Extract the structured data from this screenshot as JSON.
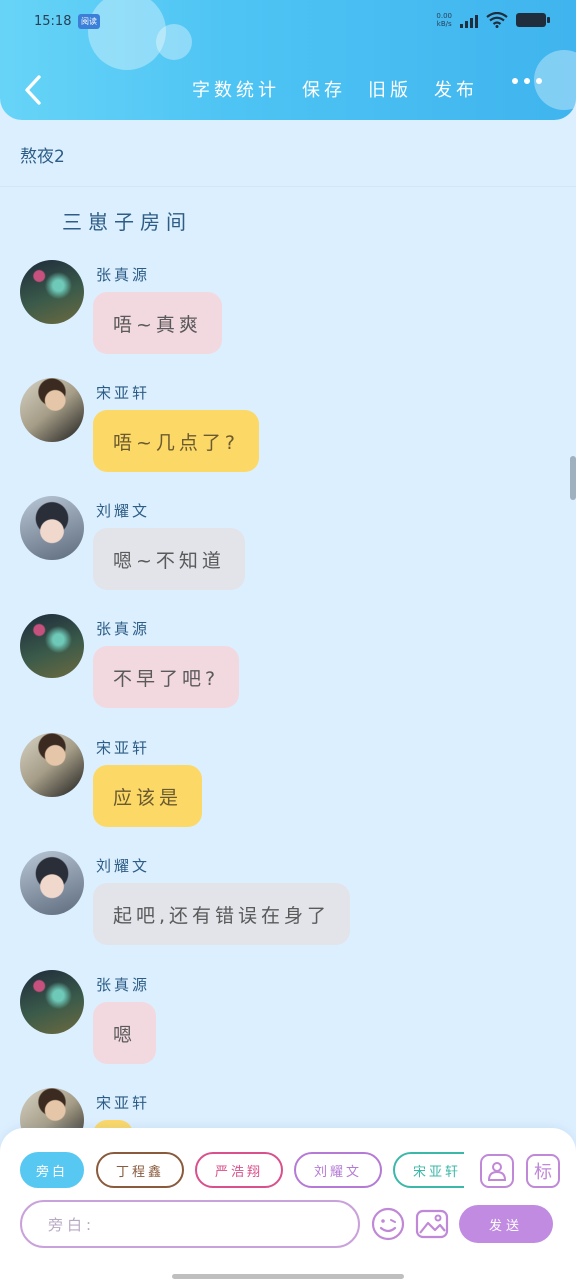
{
  "status_bar": {
    "time": "15:18",
    "chip": "阅读",
    "net_speed_top": "0.00",
    "net_speed_bottom": "kB/s",
    "net_type": "G"
  },
  "header": {
    "menu": [
      "字数统计",
      "保存",
      "旧版",
      "发布"
    ]
  },
  "room": {
    "subtitle": "熬夜2",
    "title": "三崽子房间"
  },
  "messages": [
    {
      "name": "张真源",
      "text": "唔~真爽",
      "avatar": "zhang",
      "style": "pink"
    },
    {
      "name": "宋亚轩",
      "text": "唔~几点了?",
      "avatar": "song",
      "style": "yellow"
    },
    {
      "name": "刘耀文",
      "text": "嗯~不知道",
      "avatar": "liu",
      "style": "gray"
    },
    {
      "name": "张真源",
      "text": "不早了吧?",
      "avatar": "zhang",
      "style": "pink"
    },
    {
      "name": "宋亚轩",
      "text": "应该是",
      "avatar": "song",
      "style": "yellow"
    },
    {
      "name": "刘耀文",
      "text": "起吧,还有错误在身了",
      "avatar": "liu",
      "style": "gray"
    },
    {
      "name": "张真源",
      "text": "嗯",
      "avatar": "zhang",
      "style": "pink"
    },
    {
      "name": "宋亚轩",
      "text": "",
      "avatar": "song",
      "style": "yellow"
    }
  ],
  "roles": [
    {
      "label": "旁白",
      "color": "#57c8f2",
      "active": true
    },
    {
      "label": "丁程鑫",
      "color": "#8a5a3c",
      "active": false
    },
    {
      "label": "严浩翔",
      "color": "#d9508c",
      "active": false
    },
    {
      "label": "刘耀文",
      "color": "#b57ad6",
      "active": false
    },
    {
      "label": "宋亚轩",
      "color": "#3cb8a8",
      "active": false
    }
  ],
  "composer": {
    "placeholder": "旁白:",
    "send_label": "发送",
    "mark_label": "标"
  },
  "icons": [
    "back-icon",
    "more-icon",
    "person-icon",
    "mark-icon",
    "emoji-icon",
    "image-icon",
    "wifi-icon",
    "signal-icon",
    "battery-icon"
  ]
}
